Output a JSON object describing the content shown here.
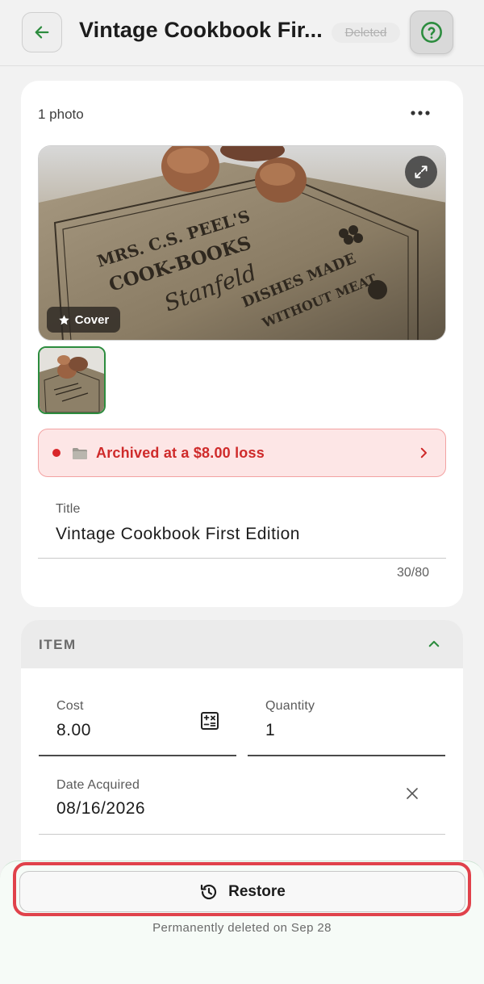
{
  "header": {
    "title": "Vintage Cookbook Fir...",
    "status_badge": "Deleted"
  },
  "photos": {
    "count_label": "1 photo",
    "cover_label": "Cover",
    "cover_text": [
      "MRS. C.S. PEEL'S",
      "COOK-BOOKS",
      "Stanfeld",
      "DISHES MADE",
      "WITHOUT MEAT"
    ]
  },
  "archive_banner": {
    "text": "Archived at a $8.00 loss"
  },
  "title_field": {
    "label": "Title",
    "value": "Vintage Cookbook First Edition",
    "counter": "30/80"
  },
  "item_section": {
    "header": "ITEM",
    "cost": {
      "label": "Cost",
      "value": "8.00"
    },
    "quantity": {
      "label": "Quantity",
      "value": "1"
    },
    "date_acquired": {
      "label": "Date Acquired",
      "value": "08/16/2026"
    }
  },
  "footer": {
    "restore_label": "Restore",
    "deleted_note": "Permanently deleted on Sep 28"
  },
  "colors": {
    "accent_green": "#2c8c3e",
    "danger_red": "#cf2a2a",
    "highlight_outline": "#e0424b"
  },
  "icons": [
    "arrow-left-icon",
    "help-circle-icon",
    "more-horizontal-icon",
    "expand-icon",
    "star-icon",
    "folder-icon",
    "chevron-right-icon",
    "chevron-up-icon",
    "calculator-icon",
    "close-icon",
    "restore-history-icon"
  ]
}
